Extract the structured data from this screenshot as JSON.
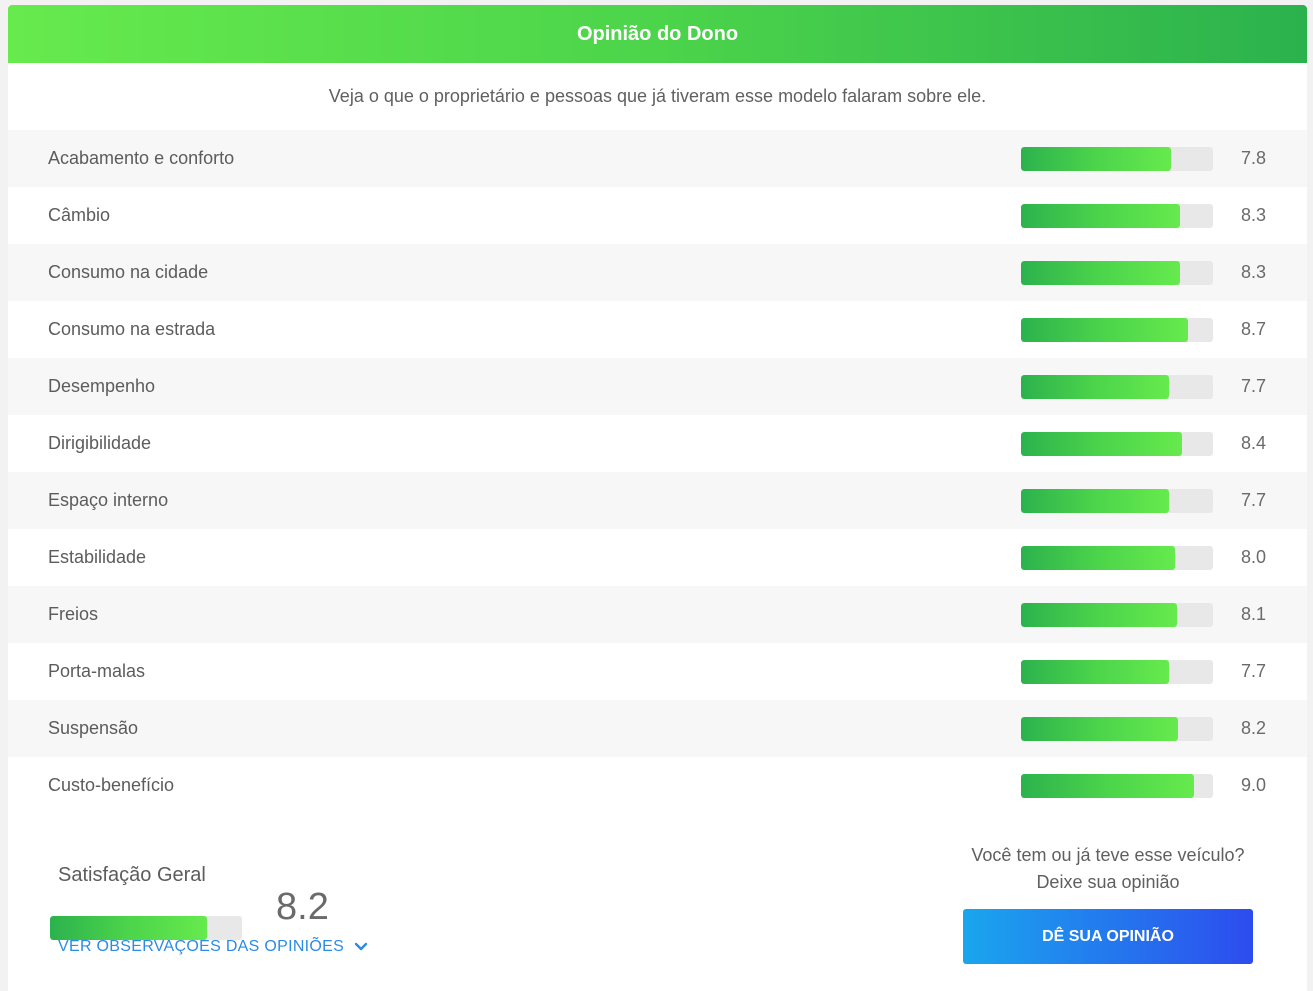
{
  "header": {
    "title": "Opinião do Dono"
  },
  "subtitle": "Veja o que o proprietário e pessoas que já tiveram esse modelo falaram sobre ele.",
  "ratings": [
    {
      "label": "Acabamento e conforto",
      "value": "7.8",
      "fraction": 0.78
    },
    {
      "label": "Câmbio",
      "value": "8.3",
      "fraction": 0.83
    },
    {
      "label": "Consumo na cidade",
      "value": "8.3",
      "fraction": 0.83
    },
    {
      "label": "Consumo na estrada",
      "value": "8.7",
      "fraction": 0.87
    },
    {
      "label": "Desempenho",
      "value": "7.7",
      "fraction": 0.77
    },
    {
      "label": "Dirigibilidade",
      "value": "8.4",
      "fraction": 0.84
    },
    {
      "label": "Espaço interno",
      "value": "7.7",
      "fraction": 0.77
    },
    {
      "label": "Estabilidade",
      "value": "8.0",
      "fraction": 0.8
    },
    {
      "label": "Freios",
      "value": "8.1",
      "fraction": 0.81
    },
    {
      "label": "Porta-malas",
      "value": "7.7",
      "fraction": 0.77
    },
    {
      "label": "Suspensão",
      "value": "8.2",
      "fraction": 0.82
    },
    {
      "label": "Custo-benefício",
      "value": "9.0",
      "fraction": 0.9
    }
  ],
  "overall": {
    "title": "Satisfação Geral",
    "value": "8.2",
    "fraction": 0.82,
    "link_label": "VER OBSERVAÇÕES DAS OPINIÕES",
    "link_icon": "chevron-down-icon"
  },
  "cta": {
    "line1": "Você tem ou já teve esse veículo?",
    "line2": "Deixe sua opinião",
    "button_label": "DÊ SUA OPINIÃO"
  },
  "colors": {
    "header_gradient": [
      "#66ea4d",
      "#2cb24d"
    ],
    "bar_gradient": [
      "#2cb24d",
      "#66ea4d"
    ],
    "bar_track": "#e8e8e8",
    "link": "#2b8be6",
    "button_gradient": [
      "#1aa6ee",
      "#2d4cee"
    ]
  }
}
